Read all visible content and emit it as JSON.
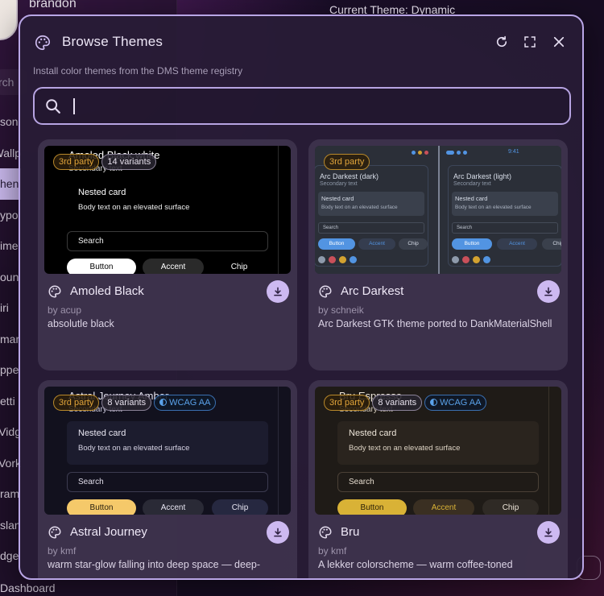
{
  "background": {
    "username": "brandon",
    "search_placeholder": "rch",
    "current_theme": "Current Theme: Dynamic",
    "nav_items": [
      {
        "label": "son"
      },
      {
        "label": "Wallp"
      },
      {
        "label": "hen",
        "active": true
      },
      {
        "label": "ypo"
      },
      {
        "label": "ime"
      },
      {
        "label": "oun"
      },
      {
        "label": "iri"
      },
      {
        "label": "mar"
      },
      {
        "label": "ppe"
      },
      {
        "label": "etti"
      },
      {
        "label": "Vidg"
      },
      {
        "label": "Vork"
      },
      {
        "label": "ram"
      },
      {
        "label": "slan"
      },
      {
        "label": "dge"
      }
    ],
    "dashboard": "Dashboard"
  },
  "modal": {
    "title": "Browse Themes",
    "subtitle": "Install color themes from the DMS theme registry",
    "search_value": "",
    "icons": {
      "palette": "palette-icon",
      "refresh": "refresh-icon",
      "fullscreen": "fullscreen-icon",
      "close": "close-icon",
      "search": "search-icon",
      "download": "download-icon"
    }
  },
  "preview_text": {
    "secondary": "Secondary text",
    "nested": "Nested card",
    "body": "Body text on an elevated surface",
    "search": "Search",
    "button": "Button",
    "accent": "Accent",
    "chip": "Chip"
  },
  "themes": [
    {
      "name": "Amoled Black",
      "author": "by acup",
      "description": "absolutle black",
      "badge_party": "3rd party",
      "badge_variants": "14 variants",
      "preview_title": "Amoled Black white",
      "colors": {
        "bg": "#000000",
        "card": "#000000",
        "text": "#ffffff",
        "btn": "#ffffff",
        "btn_text": "#000000",
        "accent": "#2a2a2a",
        "chip": "#000000"
      }
    },
    {
      "name": "Arc Darkest",
      "author": "by schneik",
      "description": "Arc Darkest GTK theme ported to DankMaterialShell",
      "badge_party": "3rd party",
      "preview_dark_title": "Arc Darkest (dark)",
      "preview_light_title": "Arc Darkest (light)",
      "preview_time": "9:41",
      "colors": {
        "bg": "#262a33",
        "accent": "#5294e2"
      },
      "swatches": [
        "#8e9aab",
        "#c9505a",
        "#d3a230",
        "#5294e2"
      ]
    },
    {
      "name": "Astral Journey",
      "author": "by kmf",
      "description": "warm star-glow falling into deep space — deep-",
      "badge_party": "3rd party",
      "badge_variants": "8 variants",
      "badge_wcag": "WCAG AA",
      "preview_title": "Astral Journey Amber",
      "colors": {
        "bg": "#12111e",
        "card": "#1c1c2e",
        "text": "#e8e6f2",
        "btn": "#f5c96a",
        "btn_text": "#2a2110",
        "accent": "#2a2a36",
        "chip": "#262840"
      }
    },
    {
      "name": "Bru",
      "author": "by kmf",
      "description": "A lekker colorscheme — warm coffee-toned",
      "badge_party": "3rd party",
      "badge_variants": "8 variants",
      "badge_wcag": "WCAG AA",
      "preview_title": "Bru Espresso",
      "colors": {
        "bg": "#1f1b17",
        "card": "#2a241e",
        "text": "#ece4d8",
        "btn": "#d9b236",
        "btn_text": "#2b2008",
        "accent": "#3a2f22",
        "chip": "#2f2a25"
      }
    }
  ]
}
